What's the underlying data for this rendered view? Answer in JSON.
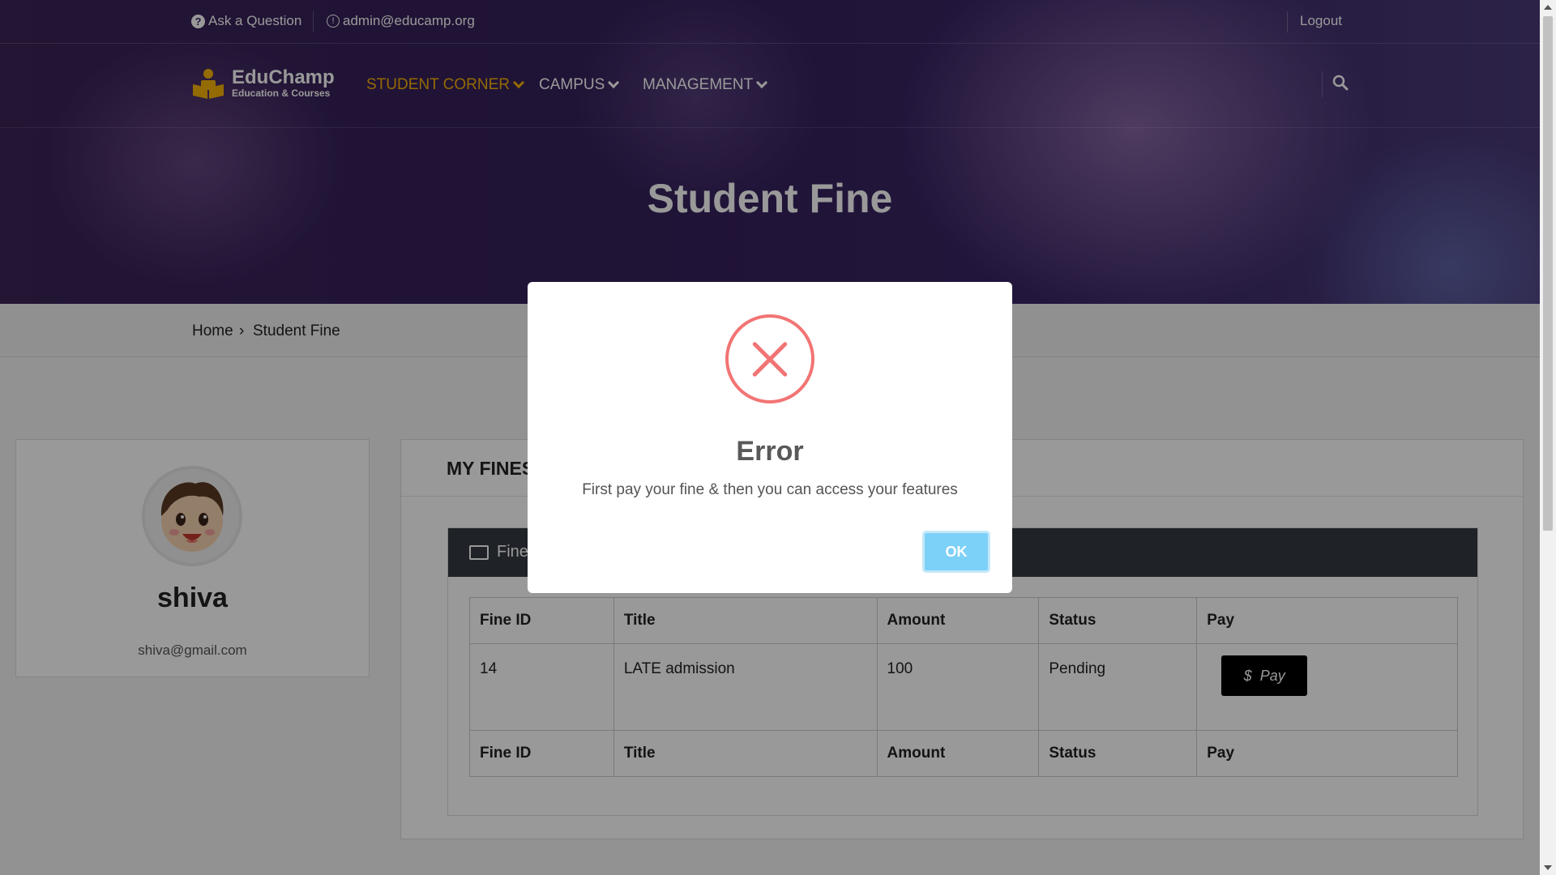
{
  "topbar": {
    "ask_label": "Ask a Question",
    "email": "admin@educamp.org",
    "logout_label": "Logout"
  },
  "brand": {
    "name": "EduChamp",
    "tagline": "Education & Courses",
    "accent_color": "#f7b205"
  },
  "nav": {
    "items": [
      {
        "label": "STUDENT CORNER",
        "active": true
      },
      {
        "label": "CAMPUS",
        "active": false
      },
      {
        "label": "MANAGEMENT",
        "active": false
      }
    ]
  },
  "page": {
    "title": "Student Fine"
  },
  "breadcrumb": {
    "home": "Home",
    "separator": "›",
    "current": "Student Fine"
  },
  "profile": {
    "name": "shiva",
    "email": "shiva@gmail.com"
  },
  "fines": {
    "heading": "MY FINES",
    "bar_label": "Fine",
    "columns": [
      "Fine ID",
      "Title",
      "Amount",
      "Status",
      "Pay"
    ],
    "rows": [
      {
        "id": "14",
        "title": "LATE admission",
        "amount": "100",
        "status": "Pending",
        "pay_label": "Pay",
        "pay_icon": "$"
      }
    ]
  },
  "modal": {
    "title": "Error",
    "message": "First pay your fine & then you can access your features",
    "ok_label": "OK",
    "icon": "error-x-icon",
    "icon_color": "#f27474"
  }
}
